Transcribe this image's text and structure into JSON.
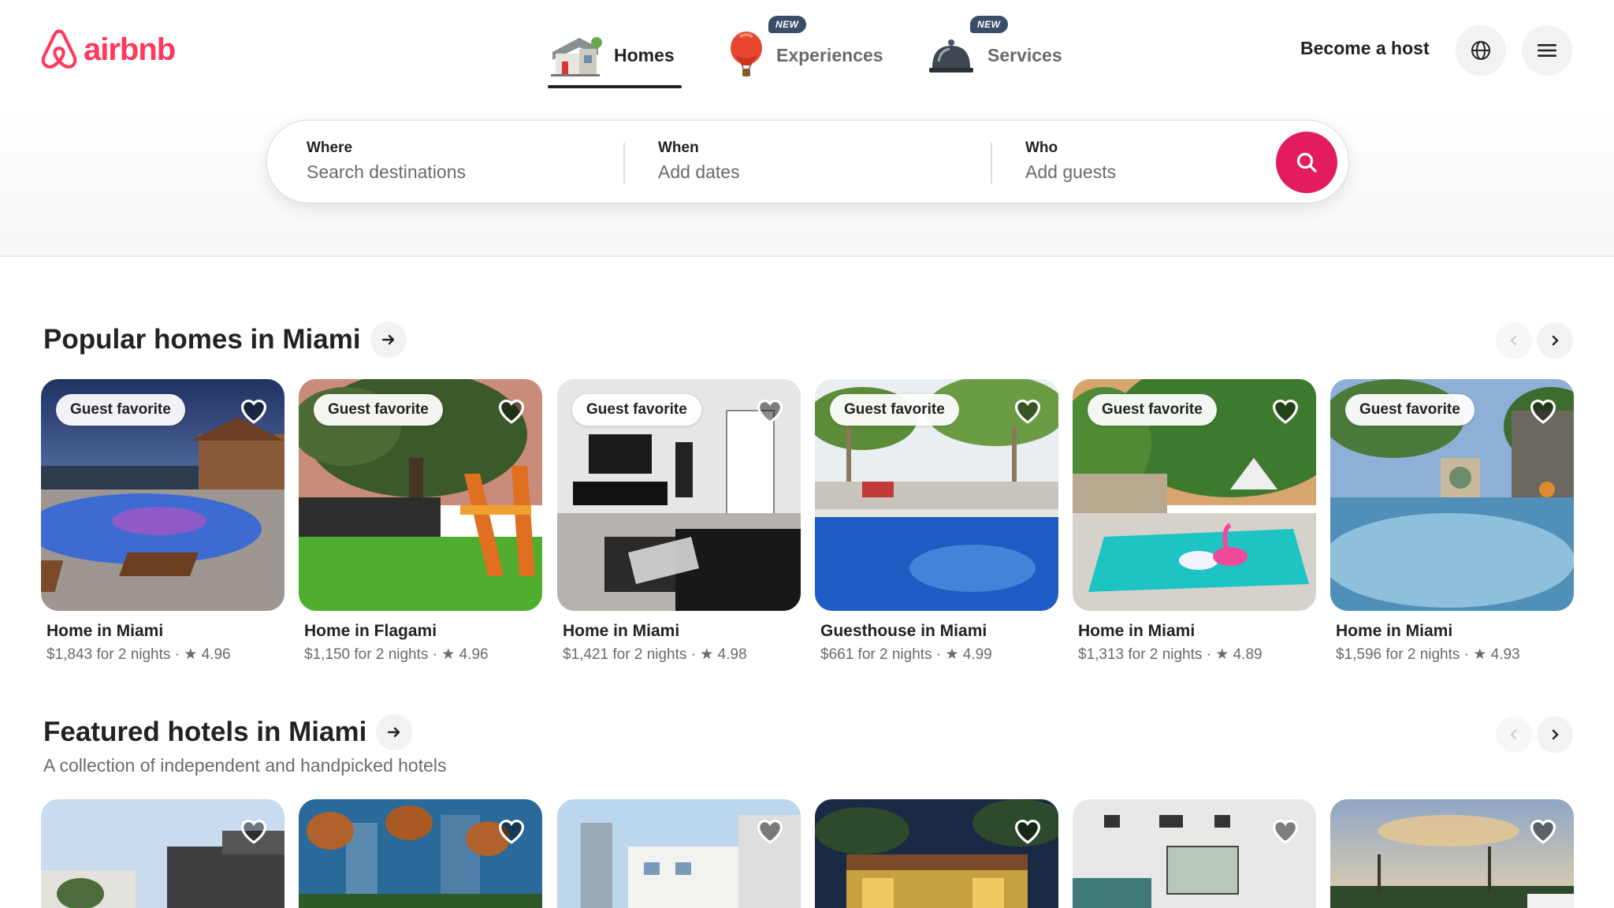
{
  "brand": {
    "name": "airbnb",
    "color": "#ff385c"
  },
  "nav": {
    "tabs": [
      {
        "label": "Homes",
        "icon": "house-icon",
        "active": true,
        "badge": ""
      },
      {
        "label": "Experiences",
        "icon": "hot-air-balloon-icon",
        "active": false,
        "badge": "NEW"
      },
      {
        "label": "Services",
        "icon": "service-bell-icon",
        "active": false,
        "badge": "NEW"
      }
    ]
  },
  "header_actions": {
    "host_label": "Become a host",
    "globe_icon": "globe-icon",
    "menu_icon": "hamburger-menu-icon"
  },
  "search": {
    "where_label": "Where",
    "where_placeholder": "Search destinations",
    "when_label": "When",
    "when_placeholder": "Add dates",
    "who_label": "Who",
    "who_placeholder": "Add guests",
    "button_icon": "search-icon",
    "accent": "#e31c5f"
  },
  "popular": {
    "title": "Popular homes in Miami",
    "listings": [
      {
        "badge": "Guest favorite",
        "name": "Home in Miami",
        "price": "$1,843 for 2 nights",
        "rating": "4.96"
      },
      {
        "badge": "Guest favorite",
        "name": "Home in Flagami",
        "price": "$1,150 for 2 nights",
        "rating": "4.96"
      },
      {
        "badge": "Guest favorite",
        "name": "Home in Miami",
        "price": "$1,421 for 2 nights",
        "rating": "4.98"
      },
      {
        "badge": "Guest favorite",
        "name": "Guesthouse in Miami",
        "price": "$661 for 2 nights",
        "rating": "4.99"
      },
      {
        "badge": "Guest favorite",
        "name": "Home in Miami",
        "price": "$1,313 for 2 nights",
        "rating": "4.89"
      },
      {
        "badge": "Guest favorite",
        "name": "Home in Miami",
        "price": "$1,596 for 2 nights",
        "rating": "4.93"
      }
    ]
  },
  "hotels": {
    "title": "Featured hotels in Miami",
    "subtitle": "A collection of independent and handpicked hotels"
  },
  "separator": "·",
  "star": "★"
}
